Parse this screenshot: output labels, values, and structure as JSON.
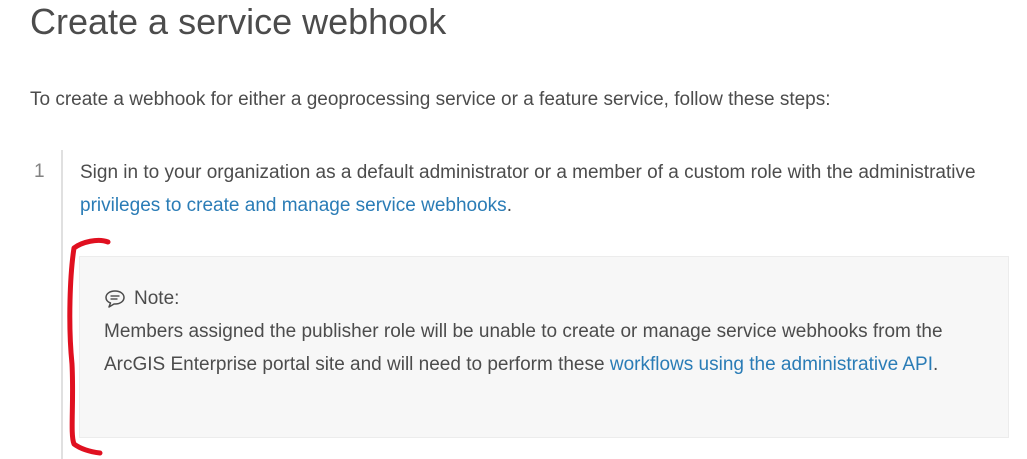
{
  "header": {
    "title": "Create a service webhook"
  },
  "intro": {
    "text": "To create a webhook for either a geoprocessing service or a feature service, follow these steps:"
  },
  "steps": [
    {
      "number": "1",
      "text_before": "Sign in to your organization as a default administrator or a member of a custom role with the administrative ",
      "link_text": "privileges to create and manage service webhooks",
      "text_after": "."
    }
  ],
  "note": {
    "label": "Note:",
    "icon": "speech-bubble-icon",
    "text_before": "Members assigned the publisher role will be unable to create or manage service webhooks from the ArcGIS Enterprise portal site and will need to perform these ",
    "link_text": "workflows using the administrative API",
    "text_after": "."
  },
  "colors": {
    "text": "#4c4c4c",
    "link": "#2a7cb6",
    "note_background": "#f7f7f7",
    "annotation_red": "#e01020"
  }
}
